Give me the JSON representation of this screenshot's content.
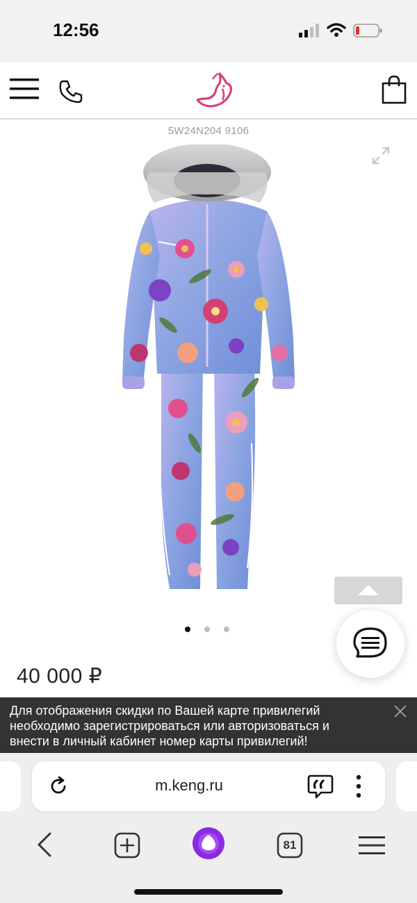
{
  "status_bar": {
    "time": "12:56"
  },
  "header": {
    "icons": [
      "menu-icon",
      "phone-icon",
      "kangaroo-logo",
      "shopping-bag-icon"
    ],
    "logo_color": "#d9407f"
  },
  "product": {
    "sku": "5W24N204 9106",
    "price": "40 000 ₽",
    "gallery": {
      "total_images": 3,
      "active_index": 0
    }
  },
  "banner": {
    "text": "Для отображения скидки по Вашей карте привилегий необходимо зарегистрироваться или авторизоваться и внести в личный кабинет номер карты привилегий!"
  },
  "browser": {
    "url": "m.keng.ru",
    "tab_count": "81",
    "alice_color": "#8a2be2"
  }
}
